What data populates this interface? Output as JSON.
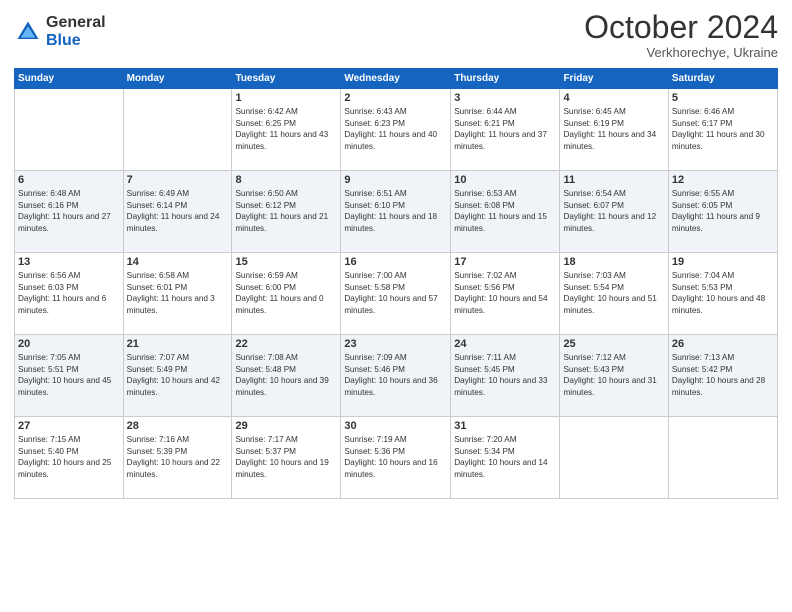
{
  "logo": {
    "general": "General",
    "blue": "Blue"
  },
  "title": "October 2024",
  "subtitle": "Verkhorechye, Ukraine",
  "days_of_week": [
    "Sunday",
    "Monday",
    "Tuesday",
    "Wednesday",
    "Thursday",
    "Friday",
    "Saturday"
  ],
  "weeks": [
    [
      {
        "day": "",
        "sunrise": "",
        "sunset": "",
        "daylight": ""
      },
      {
        "day": "",
        "sunrise": "",
        "sunset": "",
        "daylight": ""
      },
      {
        "day": "1",
        "sunrise": "Sunrise: 6:42 AM",
        "sunset": "Sunset: 6:25 PM",
        "daylight": "Daylight: 11 hours and 43 minutes."
      },
      {
        "day": "2",
        "sunrise": "Sunrise: 6:43 AM",
        "sunset": "Sunset: 6:23 PM",
        "daylight": "Daylight: 11 hours and 40 minutes."
      },
      {
        "day": "3",
        "sunrise": "Sunrise: 6:44 AM",
        "sunset": "Sunset: 6:21 PM",
        "daylight": "Daylight: 11 hours and 37 minutes."
      },
      {
        "day": "4",
        "sunrise": "Sunrise: 6:45 AM",
        "sunset": "Sunset: 6:19 PM",
        "daylight": "Daylight: 11 hours and 34 minutes."
      },
      {
        "day": "5",
        "sunrise": "Sunrise: 6:46 AM",
        "sunset": "Sunset: 6:17 PM",
        "daylight": "Daylight: 11 hours and 30 minutes."
      }
    ],
    [
      {
        "day": "6",
        "sunrise": "Sunrise: 6:48 AM",
        "sunset": "Sunset: 6:16 PM",
        "daylight": "Daylight: 11 hours and 27 minutes."
      },
      {
        "day": "7",
        "sunrise": "Sunrise: 6:49 AM",
        "sunset": "Sunset: 6:14 PM",
        "daylight": "Daylight: 11 hours and 24 minutes."
      },
      {
        "day": "8",
        "sunrise": "Sunrise: 6:50 AM",
        "sunset": "Sunset: 6:12 PM",
        "daylight": "Daylight: 11 hours and 21 minutes."
      },
      {
        "day": "9",
        "sunrise": "Sunrise: 6:51 AM",
        "sunset": "Sunset: 6:10 PM",
        "daylight": "Daylight: 11 hours and 18 minutes."
      },
      {
        "day": "10",
        "sunrise": "Sunrise: 6:53 AM",
        "sunset": "Sunset: 6:08 PM",
        "daylight": "Daylight: 11 hours and 15 minutes."
      },
      {
        "day": "11",
        "sunrise": "Sunrise: 6:54 AM",
        "sunset": "Sunset: 6:07 PM",
        "daylight": "Daylight: 11 hours and 12 minutes."
      },
      {
        "day": "12",
        "sunrise": "Sunrise: 6:55 AM",
        "sunset": "Sunset: 6:05 PM",
        "daylight": "Daylight: 11 hours and 9 minutes."
      }
    ],
    [
      {
        "day": "13",
        "sunrise": "Sunrise: 6:56 AM",
        "sunset": "Sunset: 6:03 PM",
        "daylight": "Daylight: 11 hours and 6 minutes."
      },
      {
        "day": "14",
        "sunrise": "Sunrise: 6:58 AM",
        "sunset": "Sunset: 6:01 PM",
        "daylight": "Daylight: 11 hours and 3 minutes."
      },
      {
        "day": "15",
        "sunrise": "Sunrise: 6:59 AM",
        "sunset": "Sunset: 6:00 PM",
        "daylight": "Daylight: 11 hours and 0 minutes."
      },
      {
        "day": "16",
        "sunrise": "Sunrise: 7:00 AM",
        "sunset": "Sunset: 5:58 PM",
        "daylight": "Daylight: 10 hours and 57 minutes."
      },
      {
        "day": "17",
        "sunrise": "Sunrise: 7:02 AM",
        "sunset": "Sunset: 5:56 PM",
        "daylight": "Daylight: 10 hours and 54 minutes."
      },
      {
        "day": "18",
        "sunrise": "Sunrise: 7:03 AM",
        "sunset": "Sunset: 5:54 PM",
        "daylight": "Daylight: 10 hours and 51 minutes."
      },
      {
        "day": "19",
        "sunrise": "Sunrise: 7:04 AM",
        "sunset": "Sunset: 5:53 PM",
        "daylight": "Daylight: 10 hours and 48 minutes."
      }
    ],
    [
      {
        "day": "20",
        "sunrise": "Sunrise: 7:05 AM",
        "sunset": "Sunset: 5:51 PM",
        "daylight": "Daylight: 10 hours and 45 minutes."
      },
      {
        "day": "21",
        "sunrise": "Sunrise: 7:07 AM",
        "sunset": "Sunset: 5:49 PM",
        "daylight": "Daylight: 10 hours and 42 minutes."
      },
      {
        "day": "22",
        "sunrise": "Sunrise: 7:08 AM",
        "sunset": "Sunset: 5:48 PM",
        "daylight": "Daylight: 10 hours and 39 minutes."
      },
      {
        "day": "23",
        "sunrise": "Sunrise: 7:09 AM",
        "sunset": "Sunset: 5:46 PM",
        "daylight": "Daylight: 10 hours and 36 minutes."
      },
      {
        "day": "24",
        "sunrise": "Sunrise: 7:11 AM",
        "sunset": "Sunset: 5:45 PM",
        "daylight": "Daylight: 10 hours and 33 minutes."
      },
      {
        "day": "25",
        "sunrise": "Sunrise: 7:12 AM",
        "sunset": "Sunset: 5:43 PM",
        "daylight": "Daylight: 10 hours and 31 minutes."
      },
      {
        "day": "26",
        "sunrise": "Sunrise: 7:13 AM",
        "sunset": "Sunset: 5:42 PM",
        "daylight": "Daylight: 10 hours and 28 minutes."
      }
    ],
    [
      {
        "day": "27",
        "sunrise": "Sunrise: 7:15 AM",
        "sunset": "Sunset: 5:40 PM",
        "daylight": "Daylight: 10 hours and 25 minutes."
      },
      {
        "day": "28",
        "sunrise": "Sunrise: 7:16 AM",
        "sunset": "Sunset: 5:39 PM",
        "daylight": "Daylight: 10 hours and 22 minutes."
      },
      {
        "day": "29",
        "sunrise": "Sunrise: 7:17 AM",
        "sunset": "Sunset: 5:37 PM",
        "daylight": "Daylight: 10 hours and 19 minutes."
      },
      {
        "day": "30",
        "sunrise": "Sunrise: 7:19 AM",
        "sunset": "Sunset: 5:36 PM",
        "daylight": "Daylight: 10 hours and 16 minutes."
      },
      {
        "day": "31",
        "sunrise": "Sunrise: 7:20 AM",
        "sunset": "Sunset: 5:34 PM",
        "daylight": "Daylight: 10 hours and 14 minutes."
      },
      {
        "day": "",
        "sunrise": "",
        "sunset": "",
        "daylight": ""
      },
      {
        "day": "",
        "sunrise": "",
        "sunset": "",
        "daylight": ""
      }
    ]
  ]
}
